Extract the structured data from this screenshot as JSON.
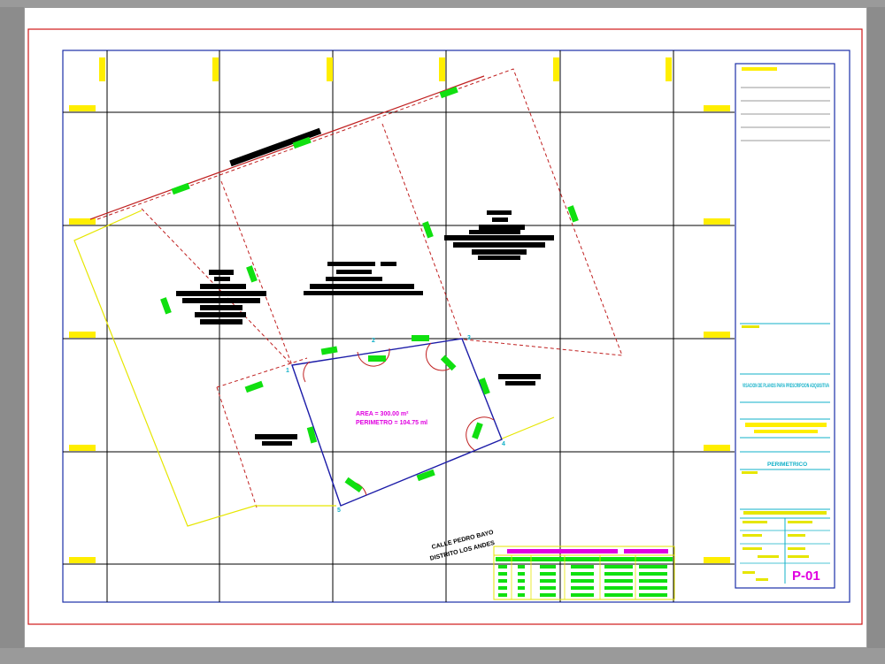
{
  "sheet": {
    "area_label": "AREA = 300.00 m²",
    "perimeter_label": "PERIMETRO = 104.75 ml",
    "vertex_labels": [
      "1",
      "2",
      "3",
      "4",
      "5"
    ],
    "road_text": [
      "CALLE PEDRO BAYO",
      "DISTRITO LOS ANDES"
    ],
    "title_block": {
      "project_title": "VISACION DE PLANOS PARA PRESCRIPCION ADQUISITIVA",
      "drawing_name": "PERIMETRICO",
      "sheet_number": "P-01"
    }
  },
  "colors": {
    "background": "#8c8c8c",
    "paper": "#ffffff",
    "outer_border": "#d01818",
    "inner_border": "#1c2ea8",
    "grid": "#000000",
    "dim_marker": "#ffee00",
    "highlight": "#00e000",
    "lot_lines": "#c02020",
    "lot_polygon": "#1c1ca8",
    "adjacent_lot": "#e6e600",
    "text_magenta": "#e000e0",
    "text_cyan": "#10b0c8"
  }
}
